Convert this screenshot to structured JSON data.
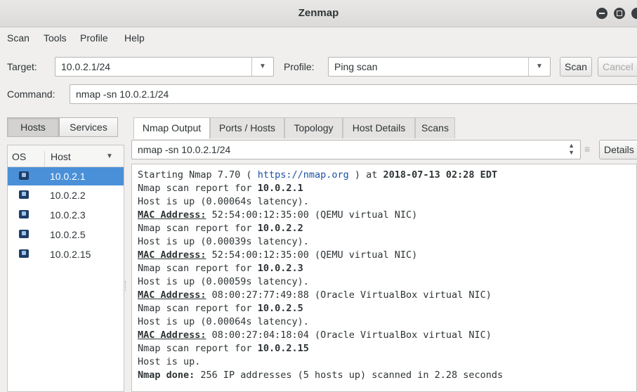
{
  "window": {
    "title": "Zenmap"
  },
  "menu": [
    "Scan",
    "Tools",
    "Profile",
    "Help"
  ],
  "toolbar": {
    "target_label": "Target:",
    "target_value": "10.0.2.1/24",
    "profile_label": "Profile:",
    "profile_value": "Ping scan",
    "scan_button": "Scan",
    "cancel_button": "Cancel"
  },
  "command": {
    "label": "Command:",
    "value": "nmap -sn 10.0.2.1/24"
  },
  "left_panel": {
    "toggles": [
      "Hosts",
      "Services"
    ],
    "columns": {
      "os": "OS",
      "host": "Host"
    },
    "hosts": [
      "10.0.2.1",
      "10.0.2.2",
      "10.0.2.3",
      "10.0.2.5",
      "10.0.2.15"
    ],
    "selected_host_index": 0
  },
  "tabs": [
    "Nmap Output",
    "Ports / Hosts",
    "Topology",
    "Host Details",
    "Scans"
  ],
  "output_selector": {
    "value": "nmap -sn 10.0.2.1/24",
    "details_button": "Details"
  },
  "output": {
    "line1_prefix": "Starting Nmap 7.70 ( ",
    "line1_link": "https://nmap.org",
    "line1_mid": " ) at ",
    "line1_date": "2018-07-13 02:28 EDT",
    "reports": [
      {
        "report_prefix": "Nmap scan report for ",
        "ip": "10.0.2.1",
        "status": "Host is up (0.00064s latency).",
        "mac_label": "MAC Address:",
        "mac_value": " 52:54:00:12:35:00 (QEMU virtual NIC)"
      },
      {
        "report_prefix": "Nmap scan report for ",
        "ip": "10.0.2.2",
        "status": "Host is up (0.00039s latency).",
        "mac_label": "MAC Address:",
        "mac_value": " 52:54:00:12:35:00 (QEMU virtual NIC)"
      },
      {
        "report_prefix": "Nmap scan report for ",
        "ip": "10.0.2.3",
        "status": "Host is up (0.00059s latency).",
        "mac_label": "MAC Address:",
        "mac_value": " 08:00:27:77:49:88 (Oracle VirtualBox virtual NIC)"
      },
      {
        "report_prefix": "Nmap scan report for ",
        "ip": "10.0.2.5",
        "status": "Host is up (0.00064s latency).",
        "mac_label": "MAC Address:",
        "mac_value": " 08:00:27:04:18:04 (Oracle VirtualBox virtual NIC)"
      },
      {
        "report_prefix": "Nmap scan report for ",
        "ip": "10.0.2.15",
        "status": "Host is up."
      }
    ],
    "done_label": "Nmap done:",
    "done_text": " 256 IP addresses (5 hosts up) scanned in 2.28 seconds"
  },
  "colors": {
    "selection": "#4a90d9",
    "link": "#1c4fa5"
  }
}
